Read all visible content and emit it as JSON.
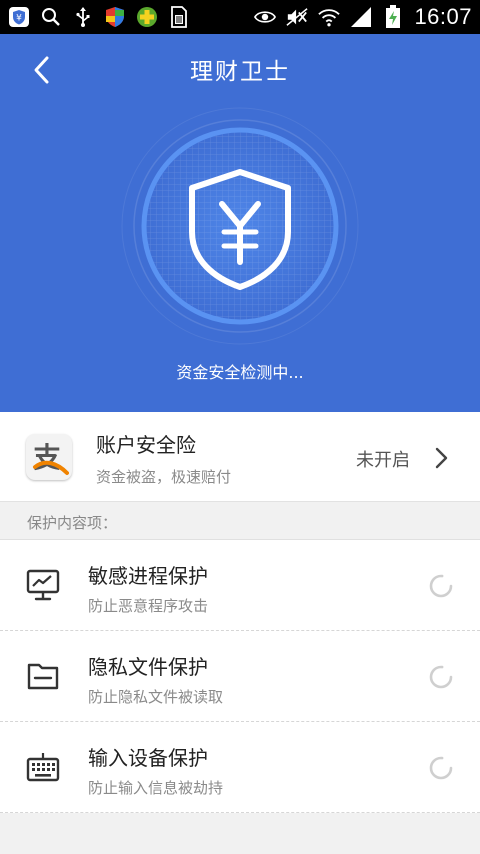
{
  "status_bar": {
    "time": "16:07",
    "icons_left": [
      "shield-app-icon",
      "search-icon",
      "usb-icon",
      "security-shield-icon",
      "plus-app-icon",
      "sd-card-icon"
    ],
    "icons_right": [
      "eye-icon",
      "mute-icon",
      "wifi-icon",
      "signal-icon",
      "battery-charging-icon"
    ]
  },
  "header": {
    "title": "理财卫士",
    "back_icon": "chevron-left-icon",
    "scan_status": "资金安全检测中..."
  },
  "insurance": {
    "title": "账户安全险",
    "subtitle": "资金被盗，极速赔付",
    "status": "未开启",
    "logo_char": "支",
    "logo_icon": "alipay-icon"
  },
  "section": {
    "label": "保护内容项："
  },
  "protection_items": [
    {
      "title": "敏感进程保护",
      "subtitle": "防止恶意程序攻击",
      "icon": "monitor-icon"
    },
    {
      "title": "隐私文件保护",
      "subtitle": "防止隐私文件被读取",
      "icon": "folder-icon"
    },
    {
      "title": "输入设备保护",
      "subtitle": "防止输入信息被劫持",
      "icon": "keyboard-icon"
    }
  ],
  "colors": {
    "header_bg": "#3f6ed4",
    "accent": "#3f6ed4",
    "alipay_orange": "#f08300"
  }
}
